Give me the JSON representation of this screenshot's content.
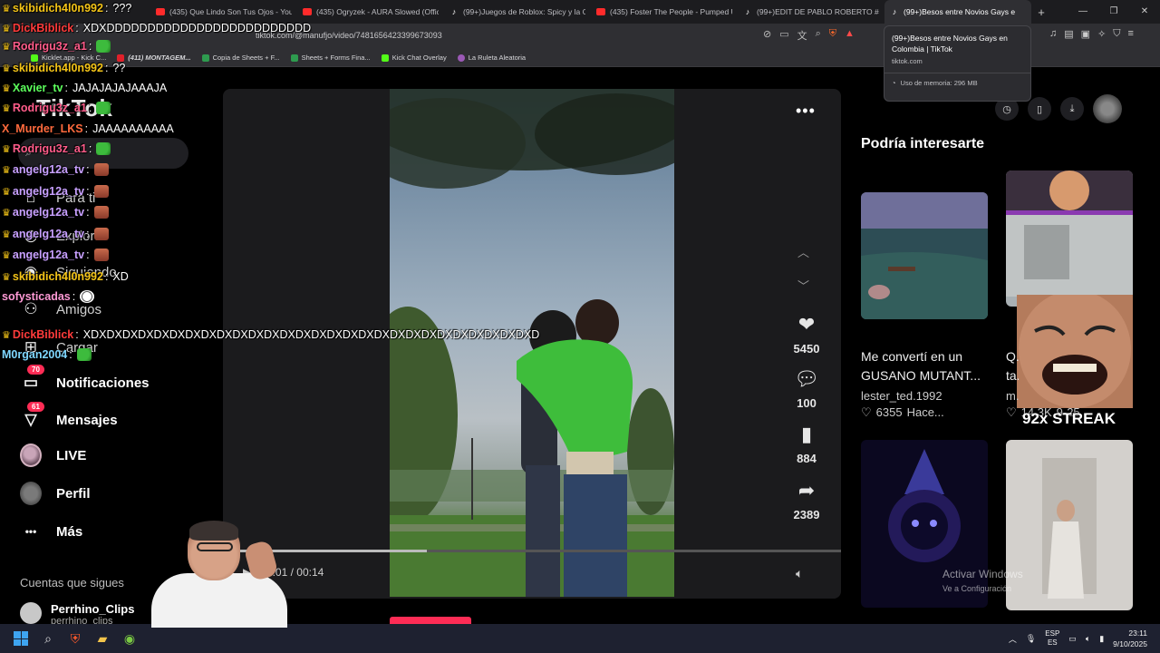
{
  "browser": {
    "tabs": [
      {
        "label": "(435) Que Lindo Son Tus Ojos - YouT",
        "type": "yt"
      },
      {
        "label": "(435) Ogryzek - AURA Slowed (Offici",
        "type": "yt"
      },
      {
        "label": "(99+)Juegos de Roblox: Spicy y la Ca",
        "type": "tt"
      },
      {
        "label": "(435) Foster The People - Pumped U",
        "type": "yt"
      },
      {
        "label": "(99+)EDIT DE PABLO ROBERTO #edi",
        "type": "tt"
      },
      {
        "label": "(99+)Besos entre Novios Gays e",
        "type": "tt",
        "active": true
      }
    ],
    "new_tab": "+",
    "url": "tiktok.com/@manufjo/video/7481656423399673093",
    "bookmarks": [
      {
        "label": "Kicklet.app - Kick C...",
        "icon": "kick"
      },
      {
        "label": "(411) MONTAGEM...",
        "icon": "yt"
      },
      {
        "label": "Copia de Sheets + F...",
        "icon": "sheets"
      },
      {
        "label": "Sheets + Forms Fina...",
        "icon": "sheets"
      },
      {
        "label": "Kick Chat Overlay",
        "icon": "kick"
      },
      {
        "label": "La Ruleta Aleatoria",
        "icon": "ruleta"
      }
    ],
    "tooltip": {
      "title": "(99+)Besos entre Novios Gays en Colombia | TikTok",
      "domain": "tiktok.com",
      "memory": "Uso de memoria: 296 MB"
    }
  },
  "sidebar": {
    "logo": "TikTok",
    "search_placeholder": "Buscar",
    "items": [
      {
        "label": "Para ti",
        "icon": "home-icon"
      },
      {
        "label": "Explorar",
        "icon": "compass-icon"
      },
      {
        "label": "Siguiendo",
        "icon": "following-icon"
      },
      {
        "label": "Amigos",
        "icon": "friends-icon"
      },
      {
        "label": "Cargar",
        "icon": "upload-icon"
      },
      {
        "label": "Notificaciones",
        "icon": "inbox-icon",
        "badge": "70"
      },
      {
        "label": "Mensajes",
        "icon": "message-icon",
        "badge": "61"
      },
      {
        "label": "LIVE",
        "icon": "live-icon"
      },
      {
        "label": "Perfil",
        "icon": "profile-icon"
      },
      {
        "label": "Más",
        "icon": "more-icon"
      }
    ],
    "following_header": "Cuentas que sigues",
    "following": [
      {
        "name": "Perrhino_Clips",
        "handle": "perrhino_clips"
      }
    ]
  },
  "video": {
    "time": "00:01 / 00:14",
    "progress": 0.33,
    "likes": "5450",
    "comments": "100",
    "saves": "884",
    "shares": "2389"
  },
  "recommendations": {
    "title": "Podría interesarte",
    "cards": [
      {
        "title": "Me convertí en un GUSANO MUTANT...",
        "author": "lester_ted.1992",
        "likes": "6355",
        "time": "Hace..."
      },
      {
        "title": "Q... ta...",
        "author": "m...",
        "likes": "14.3K",
        "time": "9-25"
      }
    ],
    "streak": "92x STREAK"
  },
  "watermark": {
    "line1": "Activar Windows",
    "line2": "Ve a Configuración"
  },
  "chat": [
    {
      "user": "skibidich4l0n992",
      "msg": "???",
      "color": "#f5c518",
      "crown": true
    },
    {
      "user": "DickBiblick",
      "msg": "XDXDDDDDDDDDDDDDDDDDDDDDDDDD",
      "color": "#ff3b3b",
      "crown": true
    },
    {
      "user": "Rodrigu3z_a1",
      "msg": "",
      "color": "#ff5c8a",
      "crown": true,
      "emote": "frog"
    },
    {
      "user": "skibidich4l0n992",
      "msg": "??",
      "color": "#f5c518",
      "crown": true
    },
    {
      "user": "Xavier_tv",
      "msg": "JAJAJAJAJAAAJA",
      "color": "#5cff5c",
      "crown": true
    },
    {
      "user": "Rodrigu3z_a1",
      "msg": "",
      "color": "#ff5c8a",
      "crown": true,
      "emote": "frog"
    },
    {
      "user": "X_Murder_LKS",
      "msg": "JAAAAAAAAAA",
      "color": "#ff6a3d",
      "crown": false
    },
    {
      "user": "Rodrigu3z_a1",
      "msg": "",
      "color": "#ff5c8a",
      "crown": true,
      "emote": "frog"
    },
    {
      "user": "angelg12a_tv",
      "msg": "",
      "color": "#c8a0ff",
      "crown": true,
      "emote": "cat"
    },
    {
      "user": "angelg12a_tv",
      "msg": "",
      "color": "#c8a0ff",
      "crown": true,
      "emote": "cat"
    },
    {
      "user": "angelg12a_tv",
      "msg": "",
      "color": "#c8a0ff",
      "crown": true,
      "emote": "cat"
    },
    {
      "user": "angelg12a_tv",
      "msg": "",
      "color": "#c8a0ff",
      "crown": true,
      "emote": "cat"
    },
    {
      "user": "angelg12a_tv",
      "msg": "",
      "color": "#c8a0ff",
      "crown": true,
      "emote": "cat"
    },
    {
      "user": "skibidich4l0n992",
      "msg": "XD",
      "color": "#f5c518",
      "crown": true
    },
    {
      "user": "sofysticadas",
      "msg": "",
      "color": "#ff9ad5",
      "crown": false,
      "emote": "ball"
    },
    {
      "user": "DickBiblick",
      "msg": "XDXDXDXDXDXDXDXDXDXDXDXDXDXDXDXDXDXDXDXDXDXDXDXDXDXDXDXDXD",
      "color": "#ff3b3b",
      "crown": true
    },
    {
      "user": "M0rgan2004",
      "msg": "",
      "color": "#7fd7ff",
      "crown": false,
      "emote": "frog"
    }
  ],
  "taskbar": {
    "lang_top": "ESP",
    "lang_bottom": "ES",
    "time": "23:11",
    "date": "9/10/2025"
  }
}
